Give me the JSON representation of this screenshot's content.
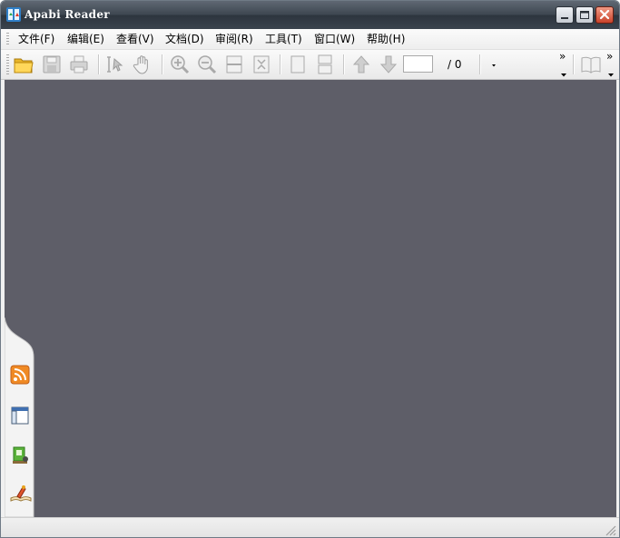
{
  "window": {
    "title": "Apabi Reader",
    "accent_colors": {
      "titlebar": "#3e4751",
      "close_button": "#c8422a",
      "workspace": "#5e5e68"
    }
  },
  "menu": {
    "items": [
      {
        "label": "文件(F)"
      },
      {
        "label": "编辑(E)"
      },
      {
        "label": "查看(V)"
      },
      {
        "label": "文档(D)"
      },
      {
        "label": "审阅(R)"
      },
      {
        "label": "工具(T)"
      },
      {
        "label": "窗口(W)"
      },
      {
        "label": "帮助(H)"
      }
    ]
  },
  "toolbar": {
    "page_input_value": "",
    "page_total": "/ 0",
    "overflow_glyph": "»",
    "buttons": [
      "open-folder-icon",
      "save-icon",
      "print-icon",
      "select-text-icon",
      "hand-icon",
      "zoom-in-icon",
      "zoom-out-icon",
      "fit-width-icon",
      "fit-page-icon",
      "single-page-icon",
      "continuous-page-icon",
      "previous-page-icon",
      "next-page-icon",
      "book-icon"
    ]
  },
  "sidebar": {
    "icons": [
      "rss-icon",
      "layout-panel-icon",
      "bookshelf-icon",
      "reading-icon"
    ]
  }
}
